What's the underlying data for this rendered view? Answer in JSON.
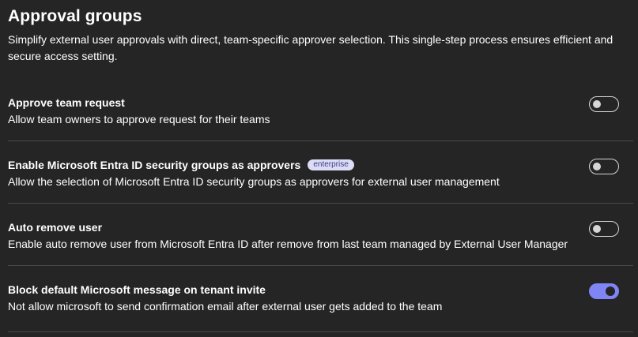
{
  "header": {
    "title": "Approval groups",
    "description": "Simplify external user approvals with direct, team-specific approver selection. This single-step process ensures efficient and secure access setting."
  },
  "settings": [
    {
      "title": "Approve team request",
      "description": "Allow team owners to approve request for their teams",
      "badge": "",
      "enabled": false
    },
    {
      "title": "Enable Microsoft Entra ID security groups as approvers",
      "description": "Allow the selection of Microsoft Entra ID security groups as approvers for external user management",
      "badge": "enterprise",
      "enabled": false
    },
    {
      "title": "Auto remove user",
      "description": "Enable auto remove user from Microsoft Entra ID after remove from last team managed by External User Manager",
      "badge": "",
      "enabled": false
    },
    {
      "title": "Block default Microsoft message on tenant invite",
      "description": "Not allow microsoft to send confirmation email after external user gets added to the team",
      "badge": "",
      "enabled": true
    }
  ],
  "colors": {
    "background": "#252525",
    "accent": "#7f85f5",
    "badge_bg": "#dcdcf4",
    "badge_text": "#3d3d8c"
  }
}
